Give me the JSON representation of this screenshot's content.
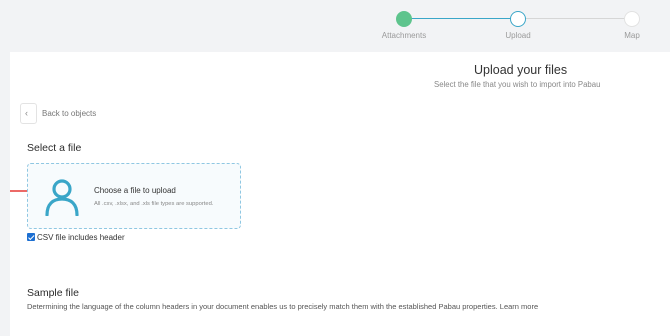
{
  "stepper": {
    "steps": [
      {
        "label": "Attachments",
        "state": "done"
      },
      {
        "label": "Upload",
        "state": "active"
      },
      {
        "label": "Map",
        "state": "todo"
      }
    ]
  },
  "header": {
    "title": "Upload your files",
    "subtitle": "Select the file that you wish to import into Pabau"
  },
  "nav": {
    "back_label": "Back to objects",
    "back_icon": "chevron-left-icon"
  },
  "select_file": {
    "title": "Select a file",
    "dropzone_title": "Choose a file to upload",
    "dropzone_subtitle": "All .csv, .xlsx, and .xls file types are supported.",
    "icon": "user-icon"
  },
  "csv_header": {
    "label": "CSV file includes header",
    "checked": true
  },
  "sample": {
    "title": "Sample file",
    "description": "Determining the language of the column headers in your document enables us to precisely match them with the established Pabau properties. Learn more"
  },
  "colors": {
    "done": "#5ec48d",
    "active": "#3aa6c8",
    "annotation_arrow": "#e53935"
  }
}
